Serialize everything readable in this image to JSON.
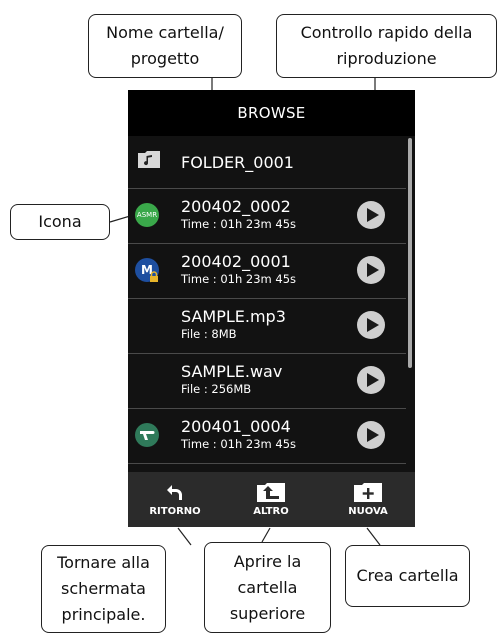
{
  "callouts": {
    "folder_name": "Nome cartella/\nprogetto",
    "quick_play": "Controllo rapido della\nriproduzione",
    "icon": "Icona",
    "back": "Tornare alla\nschermata\nprincipale.",
    "open_parent": "Aprire la\ncartella\nsuperiore",
    "create_folder": "Crea cartella"
  },
  "screen": {
    "title": "BROWSE",
    "folder": {
      "name": "FOLDER_0001",
      "icon": "music-folder-icon"
    },
    "items": [
      {
        "name": "200402_0002",
        "detail": "Time : 01h 23m 45s",
        "icon": "asmr-badge-icon",
        "icon_text": "ASMR",
        "icon_color": "#3aa84a"
      },
      {
        "name": "200402_0001",
        "detail": "Time : 01h 23m 45s",
        "icon": "mic-locked-icon",
        "icon_text": "M",
        "icon_color": "#1e4fa0"
      },
      {
        "name": "SAMPLE.mp3",
        "detail": "File : 8MB",
        "icon": ""
      },
      {
        "name": "SAMPLE.wav",
        "detail": "File : 256MB",
        "icon": ""
      },
      {
        "name": "200401_0004",
        "detail": "Time : 01h 23m 45s",
        "icon": "handheld-mic-icon",
        "icon_color": "#2f7a5a"
      }
    ],
    "footer": {
      "back_label": "RITORNO",
      "up_label": "ALTRO",
      "new_label": "NUOVA"
    }
  }
}
